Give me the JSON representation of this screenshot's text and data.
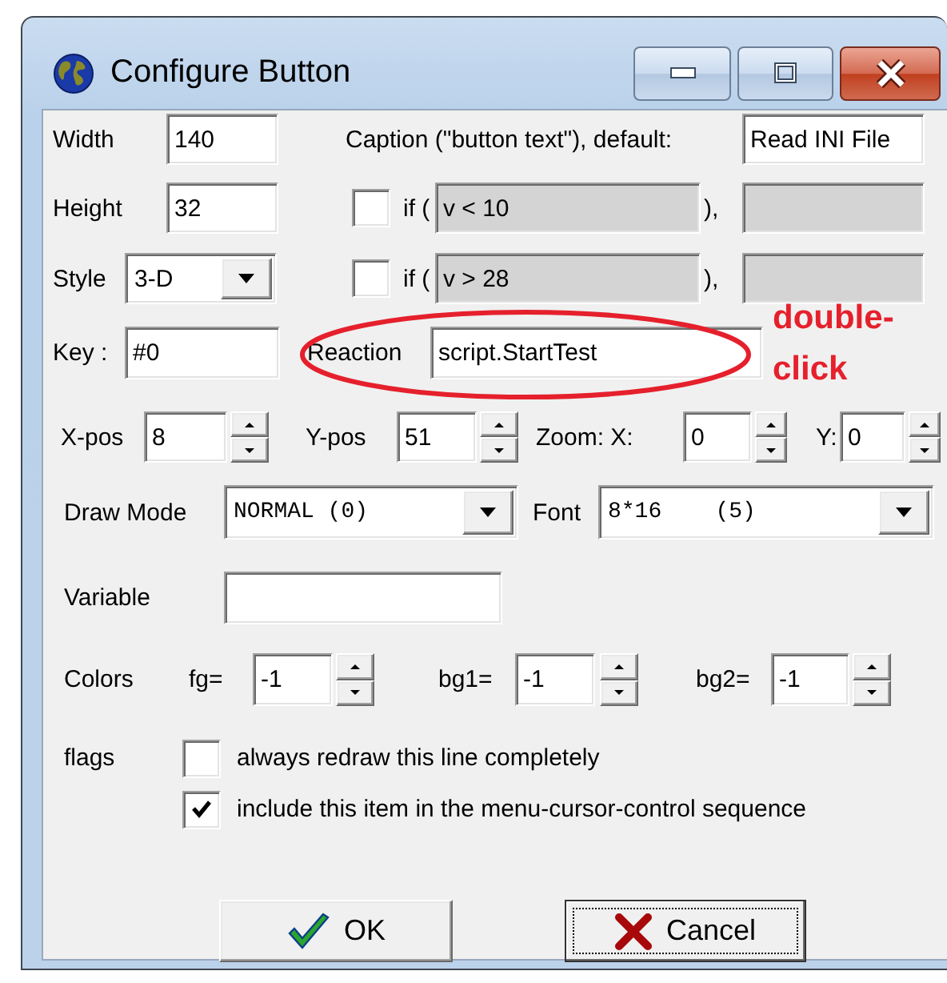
{
  "window": {
    "title": "Configure Button"
  },
  "width": {
    "label": "Width",
    "value": "140"
  },
  "caption": {
    "label": "Caption (\"button text\"), default:",
    "value": "Read INI File"
  },
  "height": {
    "label": "Height",
    "value": "32"
  },
  "style": {
    "label": "Style",
    "value": "3-D"
  },
  "conditions": [
    {
      "checked": false,
      "disabled": true,
      "prefix": "if (",
      "condition": "v < 10",
      "suffix": "),"
    },
    {
      "checked": false,
      "disabled": true,
      "prefix": "if (",
      "condition": "v > 28",
      "suffix": "),"
    }
  ],
  "key": {
    "label": "Key :",
    "value": "#0"
  },
  "reaction": {
    "label": "Reaction",
    "value": "script.StartTest"
  },
  "annotation": {
    "text": "double-click"
  },
  "position": [
    {
      "label": "X-pos",
      "value": "8"
    },
    {
      "label": "Y-pos",
      "value": "51"
    },
    {
      "label": "Zoom: X:",
      "value": "0"
    },
    {
      "label": "Y:",
      "value": "0"
    }
  ],
  "draw_mode": {
    "label": "Draw Mode",
    "value": "NORMAL (0)"
  },
  "font": {
    "label": "Font",
    "value": "8*16    (5)"
  },
  "variable": {
    "label": "Variable"
  },
  "colors": {
    "label": "Colors",
    "fields": [
      {
        "label": "fg=",
        "value": "-1"
      },
      {
        "label": "bg1=",
        "value": "-1"
      },
      {
        "label": "bg2=",
        "value": "-1"
      }
    ]
  },
  "flags": {
    "label": "flags",
    "items": [
      {
        "label": "always redraw this line completely",
        "checked": false
      },
      {
        "label": "include this item in the menu-cursor-control sequence",
        "checked": true
      }
    ]
  },
  "buttons": [
    {
      "label": "OK",
      "kind": "ok",
      "focused": false
    },
    {
      "label": "Cancel",
      "kind": "cancel",
      "focused": true
    }
  ]
}
